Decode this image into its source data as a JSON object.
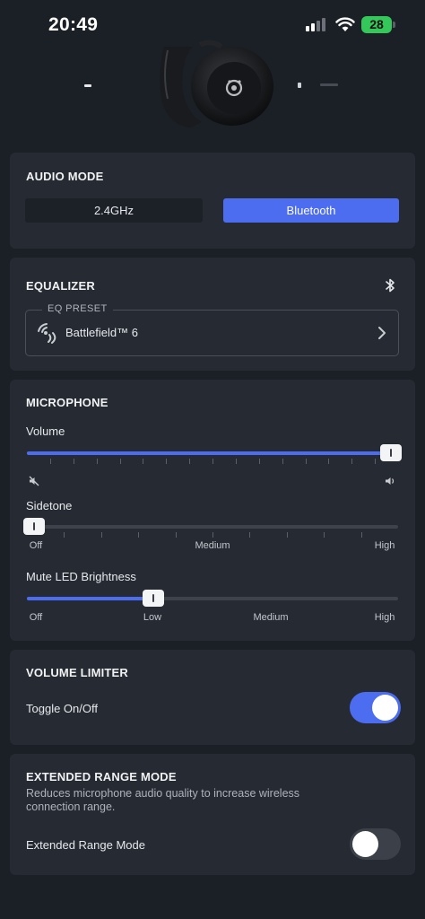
{
  "status_bar": {
    "time": "20:49",
    "battery": "28"
  },
  "audio_mode": {
    "title": "AUDIO MODE",
    "options": [
      "2.4GHz",
      "Bluetooth"
    ],
    "selected": "Bluetooth"
  },
  "equalizer": {
    "title": "EQUALIZER",
    "preset_label": "EQ PRESET",
    "preset_value": "Battlefield™ 6"
  },
  "microphone": {
    "title": "MICROPHONE",
    "volume": {
      "label": "Volume",
      "value_fraction": 0.98
    },
    "sidetone": {
      "label": "Sidetone",
      "value_fraction": 0.02,
      "scale": [
        "Off",
        "Medium",
        "High"
      ]
    },
    "mute_led": {
      "label": "Mute LED Brightness",
      "value_fraction": 0.34,
      "scale": [
        "Off",
        "Low",
        "Medium",
        "High"
      ]
    }
  },
  "volume_limiter": {
    "title": "VOLUME LIMITER",
    "toggle_label": "Toggle On/Off",
    "enabled": true
  },
  "extended_range": {
    "title": "EXTENDED RANGE MODE",
    "description": "Reduces microphone audio quality to increase wireless connection range.",
    "toggle_label": "Extended Range Mode",
    "enabled": false
  },
  "colors": {
    "accent": "#4d6df0",
    "background": "#1b1f26",
    "card": "#262b33"
  }
}
